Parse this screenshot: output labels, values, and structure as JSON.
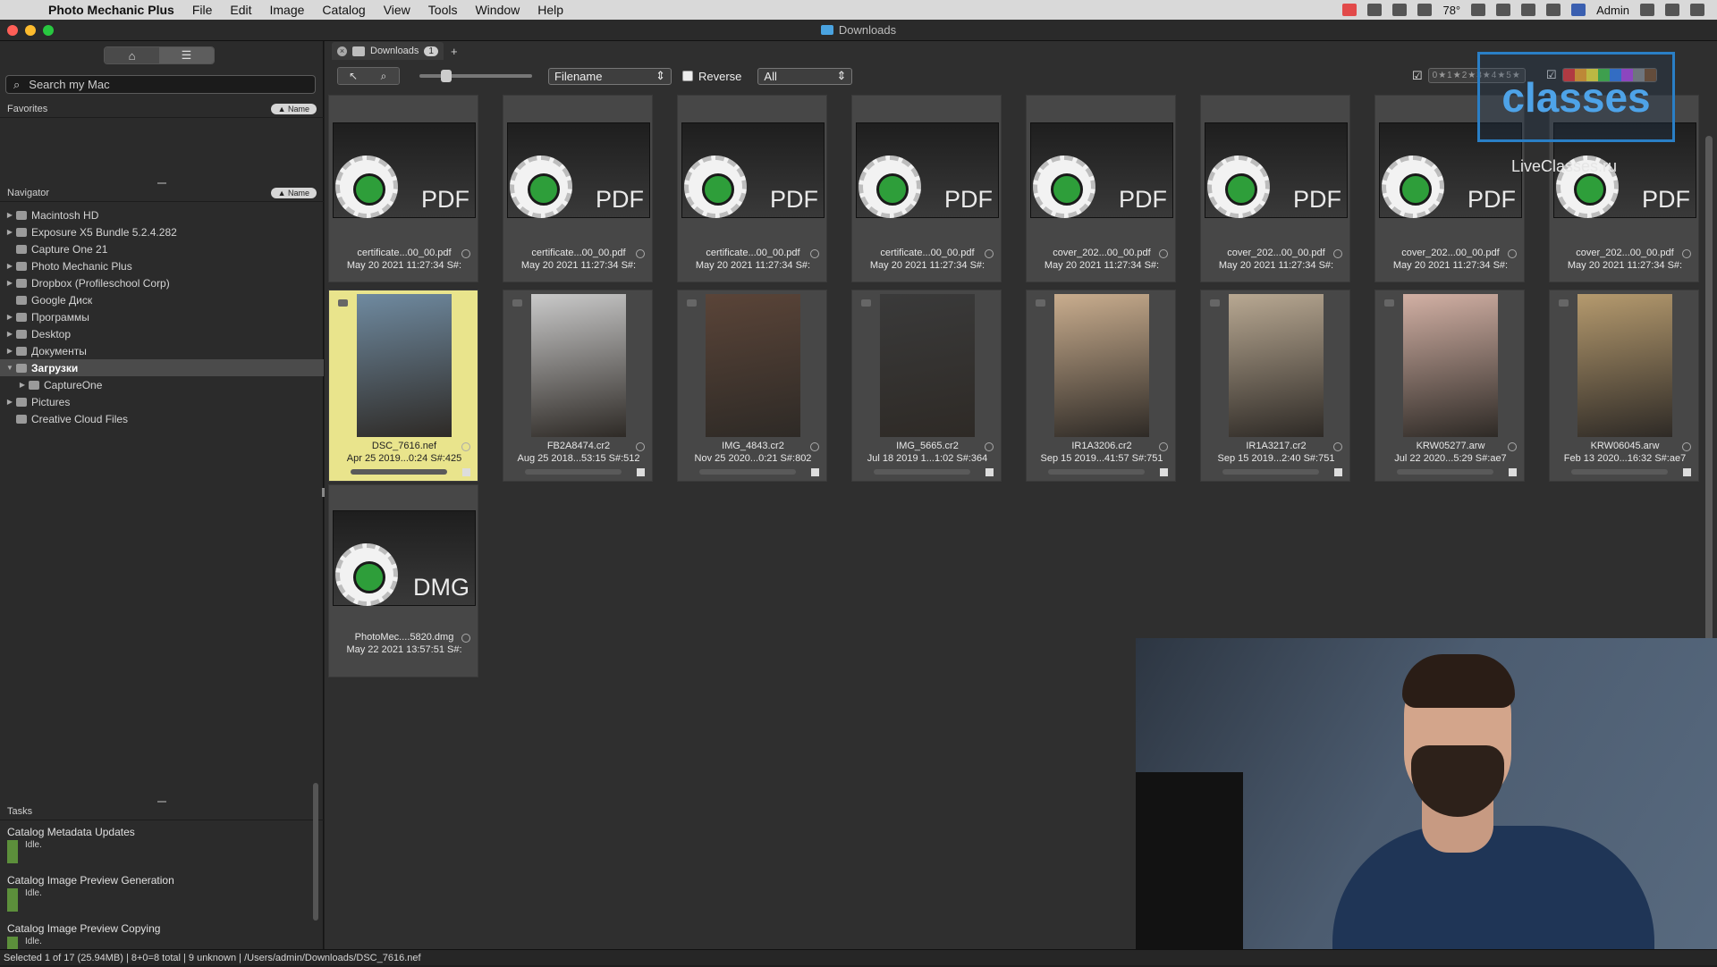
{
  "menubar": {
    "app_name": "Photo Mechanic Plus",
    "items": [
      "File",
      "Edit",
      "Image",
      "Catalog",
      "View",
      "Tools",
      "Window",
      "Help"
    ],
    "temp": "78°",
    "user": "Admin"
  },
  "window": {
    "title": "Downloads"
  },
  "sidebar": {
    "search_placeholder": "Search my Mac",
    "favorites_label": "Favorites",
    "navigator_label": "Navigator",
    "sort_label": "▲ Name",
    "nav_items": [
      {
        "label": "Macintosh HD",
        "expand": "▶",
        "indent": 0
      },
      {
        "label": "Exposure X5 Bundle 5.2.4.282",
        "expand": "▶",
        "indent": 0
      },
      {
        "label": "Capture One 21",
        "expand": "",
        "indent": 0
      },
      {
        "label": "Photo Mechanic Plus",
        "expand": "▶",
        "indent": 0
      },
      {
        "label": "Dropbox (Profileschool Corp)",
        "expand": "▶",
        "indent": 0
      },
      {
        "label": "Google Диск",
        "expand": "",
        "indent": 0
      },
      {
        "label": "Программы",
        "expand": "▶",
        "indent": 0
      },
      {
        "label": "Desktop",
        "expand": "▶",
        "indent": 0
      },
      {
        "label": "Документы",
        "expand": "▶",
        "indent": 0
      },
      {
        "label": "Загрузки",
        "expand": "▼",
        "indent": 0,
        "selected": true
      },
      {
        "label": "CaptureOne",
        "expand": "▶",
        "indent": 1
      },
      {
        "label": "Pictures",
        "expand": "▶",
        "indent": 0
      },
      {
        "label": "Creative Cloud Files",
        "expand": "",
        "indent": 0
      }
    ],
    "tasks_label": "Tasks",
    "tasks": [
      {
        "name": "Catalog Metadata Updates",
        "status": "Idle."
      },
      {
        "name": "Catalog Image Preview Generation",
        "status": "Idle."
      },
      {
        "name": "Catalog Image Preview Copying",
        "status": "Idle."
      }
    ]
  },
  "tab": {
    "label": "Downloads",
    "count": "1"
  },
  "toolbar": {
    "sort_field": "Filename",
    "reverse_label": "Reverse",
    "filter": "All",
    "rating_filter": "0★1★2★3★4★5★",
    "color_swatches": [
      "#e03a3a",
      "#f2a22b",
      "#f0e23b",
      "#49c14a",
      "#3a7ee6",
      "#b04ae0",
      "#888888",
      "#7a5230"
    ]
  },
  "thumbnails": [
    {
      "name": "certificate...00_00.pdf",
      "meta": "May 20 2021 11:27:34 S#:",
      "type": "doc",
      "ext": "PDF"
    },
    {
      "name": "certificate...00_00.pdf",
      "meta": "May 20 2021 11:27:34 S#:",
      "type": "doc",
      "ext": "PDF"
    },
    {
      "name": "certificate...00_00.pdf",
      "meta": "May 20 2021 11:27:34 S#:",
      "type": "doc",
      "ext": "PDF"
    },
    {
      "name": "certificate...00_00.pdf",
      "meta": "May 20 2021 11:27:34 S#:",
      "type": "doc",
      "ext": "PDF"
    },
    {
      "name": "cover_202...00_00.pdf",
      "meta": "May 20 2021 11:27:34 S#:",
      "type": "doc",
      "ext": "PDF"
    },
    {
      "name": "cover_202...00_00.pdf",
      "meta": "May 20 2021 11:27:34 S#:",
      "type": "doc",
      "ext": "PDF"
    },
    {
      "name": "cover_202...00_00.pdf",
      "meta": "May 20 2021 11:27:34 S#:",
      "type": "doc",
      "ext": "PDF"
    },
    {
      "name": "cover_202...00_00.pdf",
      "meta": "May 20 2021 11:27:34 S#:",
      "type": "doc",
      "ext": "PDF"
    },
    {
      "name": "DSC_7616.nef",
      "meta": "Apr 25 2019...0:24 S#:425",
      "type": "photo",
      "color": "#6f8aa0",
      "selected": true
    },
    {
      "name": "FB2A8474.cr2",
      "meta": "Aug 25 2018...53:15 S#:512",
      "type": "photo",
      "color": "#c9c9c9"
    },
    {
      "name": "IMG_4843.cr2",
      "meta": "Nov 25 2020...0:21 S#:802",
      "type": "photo",
      "color": "#5a4438"
    },
    {
      "name": "IMG_5665.cr2",
      "meta": "Jul 18 2019 1...1:02 S#:364",
      "type": "photo",
      "color": "#3a3a3a"
    },
    {
      "name": "IR1A3206.cr2",
      "meta": "Sep 15 2019...41:57 S#:751",
      "type": "photo",
      "color": "#c9ad8e"
    },
    {
      "name": "IR1A3217.cr2",
      "meta": "Sep 15 2019...2:40 S#:751",
      "type": "photo",
      "color": "#b8a892"
    },
    {
      "name": "KRW05277.arw",
      "meta": "Jul 22 2020...5:29 S#:ae7",
      "type": "photo",
      "color": "#d2b0a4"
    },
    {
      "name": "KRW06045.arw",
      "meta": "Feb 13 2020...16:32 S#:ae7",
      "type": "photo",
      "color": "#b59a6e"
    },
    {
      "name": "PhotoMec....5820.dmg",
      "meta": "May 22 2021 13:57:51 S#:",
      "type": "doc",
      "ext": "DMG"
    }
  ],
  "watermark": {
    "brand": "classes",
    "site": "LiveClasses.ru"
  },
  "statusbar": {
    "text": "Selected 1 of 17 (25.94MB) | 8+0=8 total | 9 unknown | /Users/admin/Downloads/DSC_7616.nef"
  }
}
